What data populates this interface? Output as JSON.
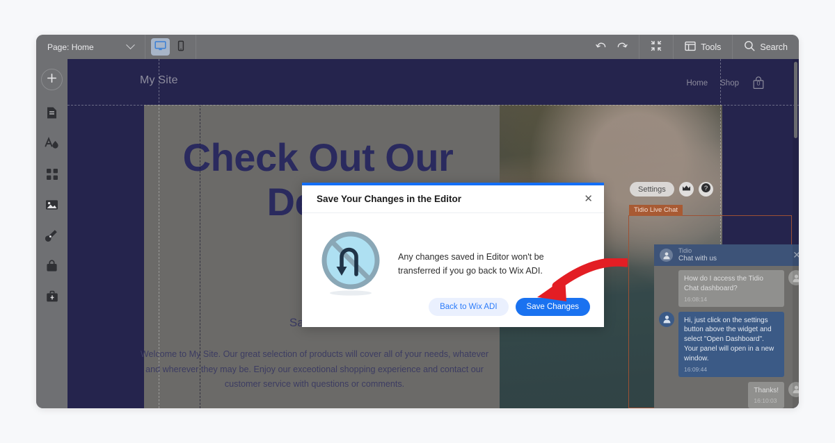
{
  "toolbar": {
    "page_label": "Page: Home",
    "chevron_icon": "chevron-down-icon",
    "desktop_icon": "desktop-monitor-icon",
    "mobile_icon": "mobile-phone-icon",
    "undo_icon": "undo-arrow-icon",
    "redo_icon": "redo-arrow-icon",
    "zoomout_icon": "zoom-out-icon",
    "tools_label": "Tools",
    "tools_icon": "panels-layout-icon",
    "search_label": "Search",
    "search_icon": "search-icon"
  },
  "sidebar": {
    "add_icon": "plus-icon",
    "items": [
      {
        "name": "pages",
        "icon": "document-pages-icon"
      },
      {
        "name": "design",
        "icon": "theme-letter-droplet-icon"
      },
      {
        "name": "apps",
        "icon": "grid-apps-icon"
      },
      {
        "name": "media",
        "icon": "image-media-icon"
      },
      {
        "name": "blog",
        "icon": "pen-nib-icon"
      },
      {
        "name": "store",
        "icon": "shopping-bag-icon"
      },
      {
        "name": "business",
        "icon": "briefcase-icon"
      }
    ]
  },
  "site": {
    "logo": "My Site",
    "nav": [
      "Home",
      "Shop"
    ],
    "cart_count": "0",
    "cart_icon": "shopping-cart-icon",
    "hero_title": "Check Out Our Deals",
    "hero_subtitle": "Save More",
    "hero_body": "Welcome to My Site. Our great selection of products will cover all of your needs, whatever and wherever they may be. Enjoy our exceotional shopping experience and contact our customer service with questions or comments."
  },
  "tidio": {
    "tag_label": "Tidio Live Chat",
    "settings_label": "Settings",
    "crown_icon": "crown-icon",
    "help_icon": "question-mark-icon",
    "close_icon": "close-icon",
    "header_title": "Tidio",
    "header_subtitle": "Chat with us",
    "avatar_icon": "user-avatar-icon",
    "messages": [
      {
        "side": "in",
        "text": "How do I access the Tidio Chat dashboard?",
        "time": "16:08:14"
      },
      {
        "side": "out",
        "text": "Hi, just click on the settings button above the widget and select \"Open Dashboard\". Your panel will open in a new window.",
        "time": "16:09:44"
      },
      {
        "side": "in",
        "text": "Thanks!",
        "time": "16:10:03"
      }
    ]
  },
  "modal": {
    "title": "Save Your Changes in the Editor",
    "close_icon": "close-icon",
    "illustration_icon": "no-u-turn-icon",
    "body_text": "Any changes saved in Editor won't be transferred if you go back to Wix ADI.",
    "secondary_button": "Back to Wix ADI",
    "primary_button": "Save Changes"
  },
  "annotation": {
    "arrow_icon": "red-curved-arrow-icon",
    "color": "#e31e24"
  },
  "colors": {
    "accent_blue": "#1a72f0",
    "canvas_navy": "#25244d",
    "chrome_grey": "#6f7073",
    "tidio_tag": "#a85a33"
  }
}
